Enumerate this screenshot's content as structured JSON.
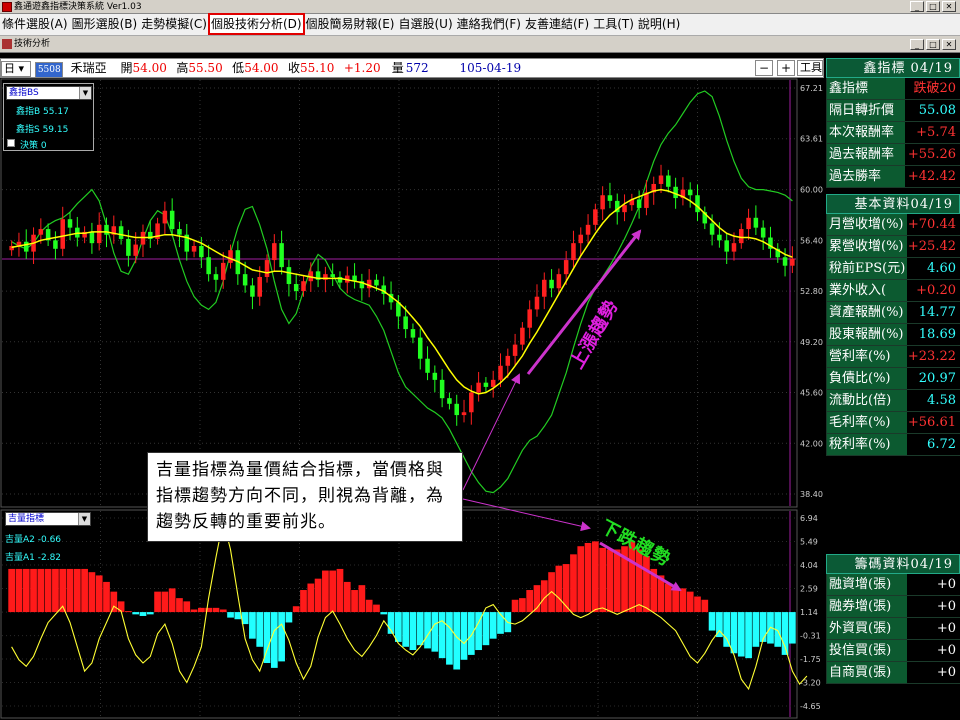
{
  "window": {
    "title": "鑫通遊鑫指標決策系統 Ver1.03",
    "controls": [
      "_",
      "□",
      "✕"
    ]
  },
  "menu": {
    "items": [
      "條件選股(A)",
      "圖形選股(B)",
      "走勢模擬(C)",
      "個股技術分析(D)",
      "個股簡易財報(E)",
      "自選股(U)",
      "連絡我們(F)",
      "友善連結(F)",
      "工具(T)",
      "說明(H)"
    ],
    "highlighted_index": 3
  },
  "subwindow": {
    "title": "技術分析",
    "controls": [
      "_",
      "□",
      "✕"
    ]
  },
  "stock_info": {
    "period": "日",
    "code": "5508",
    "name": "禾瑞亞",
    "open_label": "開",
    "open": "54.00",
    "high_label": "高",
    "high": "55.50",
    "low_label": "低",
    "low": "54.00",
    "close_label": "收",
    "close": "55.10",
    "change": "+1.20",
    "volume_label": "量",
    "volume": "572",
    "date": "105-04-19",
    "minus": "−",
    "plus": "+",
    "tools": "工具"
  },
  "colors": {
    "up": "#ff2020",
    "down": "#20ff20",
    "ma": "#ffff00",
    "band": "#22cc22",
    "histogram_pos": "#ff1a1a",
    "histogram_neg": "#22ffff",
    "oscillator": "#ffff33",
    "accent_magenta": "#cc33cc"
  },
  "main_legend": {
    "selector": "鑫指BS",
    "line1": "鑫指B 55.17",
    "line2": "鑫指S 59.15",
    "checkbox_label": "決策 0"
  },
  "sub_legend": {
    "selector": "吉量指標",
    "line1": "吉量A2 -0.66",
    "line2": "吉量A1 -2.82"
  },
  "price_axis": [
    "67.21",
    "63.61",
    "60.00",
    "56.40",
    "52.80",
    "49.20",
    "45.60",
    "42.00",
    "38.40"
  ],
  "sub_axis": [
    "6.94",
    "5.49",
    "4.04",
    "2.59",
    "1.14",
    "-0.31",
    "-1.75",
    "-3.20",
    "-4.65"
  ],
  "annotations": {
    "callout": "吉量指標為量價結合指標，當價格與指標趨勢方向不同，則視為背離，為趨勢反轉的重要前兆。",
    "up_trend": "上漲趨勢",
    "down_trend": "下跌趨勢"
  },
  "xin_panel": {
    "header": "鑫指標 04/19",
    "rows": [
      {
        "label": "鑫指標",
        "value": "跌破20",
        "color": "#ff3333"
      },
      {
        "label": "隔日轉折價",
        "value": "55.08",
        "color": "#3ff"
      },
      {
        "label": "本次報酬率",
        "value": "+5.74",
        "color": "#ff3333"
      },
      {
        "label": "過去報酬率",
        "value": "+55.26",
        "color": "#ff3333"
      },
      {
        "label": "過去勝率",
        "value": "+42.42",
        "color": "#ff3333"
      }
    ]
  },
  "fund_panel": {
    "header": "基本資料04/19",
    "rows": [
      {
        "label": "月營收增(%)",
        "value": "+70.44",
        "color": "#ff3333"
      },
      {
        "label": "累營收增(%)",
        "value": "+25.42",
        "color": "#ff3333"
      },
      {
        "label": "稅前EPS(元)",
        "value": "4.60",
        "color": "#3ff"
      },
      {
        "label": "業外收入(",
        "value": "+0.20",
        "color": "#ff3333"
      },
      {
        "label": "資產報酬(%)",
        "value": "14.77",
        "color": "#3ff"
      },
      {
        "label": "股東報酬(%)",
        "value": "18.69",
        "color": "#3ff"
      },
      {
        "label": "營利率(%)",
        "value": "+23.22",
        "color": "#ff3333"
      },
      {
        "label": "負債比(%)",
        "value": "20.97",
        "color": "#3ff"
      },
      {
        "label": "流動比(倍)",
        "value": "4.58",
        "color": "#3ff"
      },
      {
        "label": "毛利率(%)",
        "value": "+56.61",
        "color": "#ff3333"
      },
      {
        "label": "稅利率(%)",
        "value": "6.72",
        "color": "#3ff"
      }
    ]
  },
  "chip_panel": {
    "header": "籌碼資料04/19",
    "rows": [
      {
        "label": "融資增(張)",
        "value": "+0",
        "color": "#fff"
      },
      {
        "label": "融券增(張)",
        "value": "+0",
        "color": "#fff"
      },
      {
        "label": "外資買(張)",
        "value": "+0",
        "color": "#fff"
      },
      {
        "label": "投信買(張)",
        "value": "+0",
        "color": "#fff"
      },
      {
        "label": "自商買(張)",
        "value": "+0",
        "color": "#fff"
      }
    ]
  },
  "chart_data": {
    "type": "candlestick",
    "price_ylim": [
      38.4,
      67.21
    ],
    "sub_ylim": [
      -4.65,
      6.94
    ],
    "reference_price": 55.08,
    "closes": [
      56.0,
      56.3,
      55.6,
      56.8,
      57.2,
      56.4,
      55.8,
      57.9,
      57.3,
      56.6,
      57.0,
      56.2,
      57.5,
      56.8,
      57.4,
      56.5,
      55.3,
      56.1,
      57.0,
      56.5,
      57.6,
      58.5,
      57.2,
      56.8,
      55.6,
      56.0,
      55.2,
      54.0,
      53.6,
      54.8,
      55.7,
      54.0,
      53.2,
      52.4,
      53.8,
      55.0,
      56.2,
      54.5,
      53.3,
      52.8,
      53.5,
      54.2,
      53.6,
      54.0,
      53.8,
      53.4,
      53.9,
      53.5,
      53.0,
      53.6,
      53.2,
      52.6,
      52.0,
      51.0,
      50.1,
      49.5,
      48.0,
      47.0,
      46.5,
      45.2,
      44.8,
      44.0,
      44.2,
      45.6,
      46.3,
      46.0,
      46.5,
      47.5,
      48.2,
      49.0,
      50.2,
      51.5,
      52.4,
      53.6,
      53.0,
      54.0,
      55.0,
      56.2,
      56.8,
      57.5,
      58.6,
      59.6,
      59.2,
      58.4,
      58.9,
      59.3,
      58.7,
      59.8,
      60.4,
      61.0,
      60.2,
      59.4,
      60.0,
      59.6,
      58.4,
      57.6,
      56.8,
      56.4,
      55.6,
      56.2,
      57.2,
      58.0,
      57.3,
      56.6,
      55.8,
      55.2,
      54.6,
      55.1
    ],
    "ma": [
      55.9,
      56.0,
      56.1,
      56.2,
      56.4,
      56.5,
      56.6,
      56.7,
      56.8,
      56.9,
      56.9,
      57.0,
      57.0,
      57.0,
      56.9,
      56.8,
      56.7,
      56.6,
      56.6,
      56.6,
      56.7,
      56.8,
      56.8,
      56.7,
      56.6,
      56.4,
      56.2,
      55.9,
      55.6,
      55.3,
      55.1,
      54.9,
      54.6,
      54.3,
      54.2,
      54.1,
      54.2,
      54.2,
      54.1,
      54.0,
      53.9,
      53.8,
      53.7,
      53.7,
      53.7,
      53.7,
      53.6,
      53.5,
      53.4,
      53.2,
      53.0,
      52.8,
      52.4,
      52.0,
      51.5,
      50.9,
      50.3,
      49.5,
      48.8,
      48.0,
      47.2,
      46.5,
      46.0,
      45.7,
      45.5,
      45.6,
      45.9,
      46.3,
      46.8,
      47.5,
      48.2,
      49.1,
      49.9,
      50.8,
      51.7,
      52.6,
      53.5,
      54.4,
      55.3,
      56.1,
      56.9,
      57.6,
      58.2,
      58.6,
      59.0,
      59.3,
      59.5,
      59.7,
      59.9,
      60.0,
      59.9,
      59.7,
      59.5,
      59.2,
      58.8,
      58.3,
      57.8,
      57.3,
      56.9,
      56.7,
      56.6,
      56.6,
      56.5,
      56.3,
      56.0,
      55.7,
      55.4,
      55.2
    ],
    "band": [
      56.3,
      56.0,
      55.8,
      56.2,
      57.0,
      57.5,
      57.8,
      58.0,
      58.4,
      59.0,
      59.5,
      60.0,
      59.2,
      57.5,
      55.5,
      54.2,
      54.0,
      55.0,
      56.5,
      57.8,
      58.5,
      58.2,
      56.8,
      55.0,
      53.5,
      52.4,
      51.8,
      51.5,
      52.0,
      53.5,
      55.5,
      57.3,
      58.6,
      58.8,
      57.5,
      55.8,
      53.5,
      51.5,
      50.5,
      51.2,
      52.8,
      54.5,
      55.4,
      55.0,
      54.0,
      53.0,
      52.5,
      52.2,
      52.0,
      51.8,
      51.0,
      50.0,
      48.5,
      47.0,
      46.0,
      45.5,
      45.0,
      44.5,
      44.2,
      43.8,
      43.0,
      42.0,
      41.0,
      40.0,
      39.2,
      38.6,
      38.5,
      38.9,
      39.5,
      40.5,
      41.5,
      42.2,
      42.5,
      43.2,
      44.0,
      45.5,
      47.0,
      48.8,
      50.5,
      52.0,
      53.0,
      53.8,
      54.6,
      55.5,
      56.5,
      57.6,
      58.8,
      60.5,
      62.0,
      63.2,
      64.0,
      64.6,
      65.4,
      66.2,
      66.8,
      67.0,
      66.6,
      65.2,
      63.5,
      62.0,
      60.8,
      60.2,
      60.0,
      60.0,
      59.9,
      59.8,
      59.6,
      59.2
    ],
    "ji_histogram": [
      3.8,
      3.8,
      3.8,
      3.8,
      3.8,
      3.8,
      3.8,
      3.8,
      3.8,
      3.8,
      3.8,
      3.6,
      3.4,
      3.0,
      2.4,
      1.8,
      1.2,
      1.0,
      0.9,
      1.0,
      2.4,
      2.4,
      2.6,
      2.0,
      1.8,
      1.3,
      1.4,
      1.4,
      1.4,
      1.3,
      0.8,
      0.7,
      0.4,
      -0.5,
      -1.0,
      -2.0,
      -2.3,
      -1.9,
      0.5,
      1.5,
      2.5,
      2.9,
      3.2,
      3.7,
      3.7,
      3.8,
      3.0,
      2.5,
      2.8,
      1.9,
      1.6,
      1.0,
      -0.2,
      -0.7,
      -1.0,
      -1.2,
      -0.9,
      -1.1,
      -1.3,
      -1.7,
      -2.1,
      -2.4,
      -1.8,
      -1.5,
      -1.2,
      -0.9,
      -0.5,
      -0.2,
      -0.1,
      1.9,
      2.0,
      2.5,
      2.8,
      3.1,
      3.6,
      4.0,
      4.1,
      4.7,
      5.2,
      5.4,
      5.5,
      5.1,
      5.0,
      5.0,
      5.2,
      5.5,
      5.0,
      4.6,
      3.8,
      3.4,
      2.9,
      2.6,
      2.6,
      2.4,
      2.1,
      1.9,
      0.0,
      -0.4,
      -1.0,
      -1.4,
      -1.6,
      -1.7,
      -1.0,
      -0.7,
      -0.8,
      -1.0,
      -1.5,
      -0.8
    ],
    "ji_line": [
      -1.0,
      -1.8,
      -2.2,
      -1.6,
      -0.5,
      0.5,
      1.0,
      1.5,
      0.5,
      -1.0,
      -2.5,
      -2.0,
      -0.5,
      0.5,
      1.5,
      1.2,
      -0.5,
      -1.5,
      -2.0,
      -1.6,
      -0.2,
      0.4,
      -0.8,
      -2.5,
      -3.2,
      -2.2,
      -1.0,
      2.0,
      4.5,
      6.8,
      5.0,
      2.2,
      -0.5,
      -1.8,
      -2.5,
      -1.2,
      0.0,
      0.4,
      -0.6,
      -2.0,
      -3.0,
      -2.2,
      -0.4,
      0.8,
      1.2,
      0.4,
      -0.5,
      -1.2,
      -1.6,
      -1.0,
      -0.3,
      0.6,
      0.0,
      -0.8,
      -1.2,
      -1.5,
      -1.0,
      -0.3,
      0.4,
      0.6,
      0.2,
      -0.4,
      -0.8,
      -0.3,
      0.5,
      1.4,
      1.6,
      1.0,
      0.5,
      0.4,
      0.6,
      1.0,
      1.4,
      2.0,
      2.4,
      2.0,
      1.5,
      1.0,
      0.8,
      1.0,
      1.3,
      1.4,
      1.2,
      1.0,
      1.2,
      1.4,
      1.6,
      1.4,
      1.1,
      0.8,
      0.4,
      0.0,
      -0.8,
      -1.6,
      -2.0,
      -1.4,
      -0.6,
      0.0,
      -0.5,
      -1.5,
      -3.0,
      -3.6,
      -2.2,
      -0.5,
      0.2,
      0.0,
      -1.0,
      -2.5,
      -3.3,
      -2.8
    ]
  }
}
